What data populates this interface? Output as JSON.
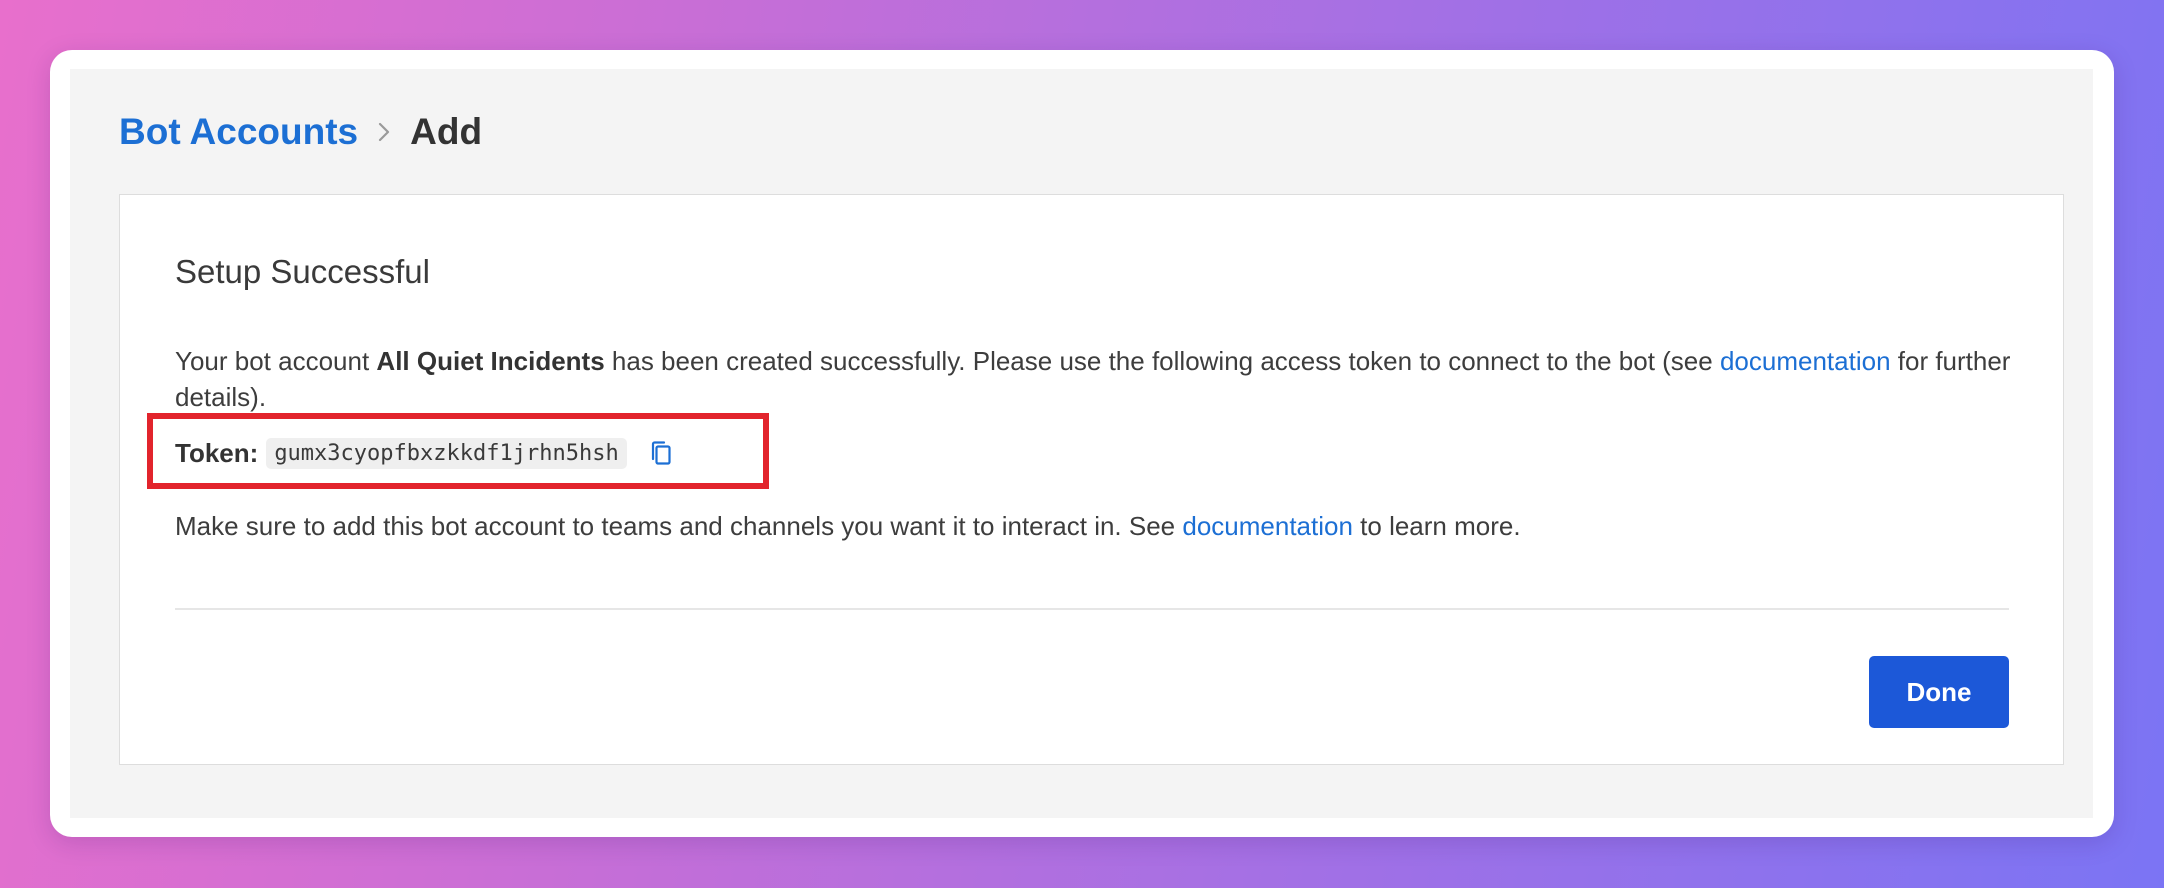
{
  "breadcrumb": {
    "parent": "Bot Accounts",
    "current": "Add"
  },
  "card": {
    "title": "Setup Successful",
    "message": {
      "prefix": "Your bot account ",
      "bot_name": "All Quiet Incidents",
      "middle": " has been created successfully. Please use the following access token to connect to the bot (see ",
      "link": "documentation",
      "suffix": " for further details)."
    },
    "token": {
      "label": "Token",
      "separator": ":",
      "value": "gumx3cyopfbxzkkdf1jrhn5hsh",
      "copy_icon": "copy-icon"
    },
    "note": {
      "prefix": "Make sure to add this bot account to teams and channels you want it to interact in. See ",
      "link": "documentation",
      "suffix": " to learn more."
    },
    "done_label": "Done"
  },
  "colors": {
    "link": "#1c6fd4",
    "primary_button": "#1c58d8",
    "highlight_border": "#e2242c"
  }
}
